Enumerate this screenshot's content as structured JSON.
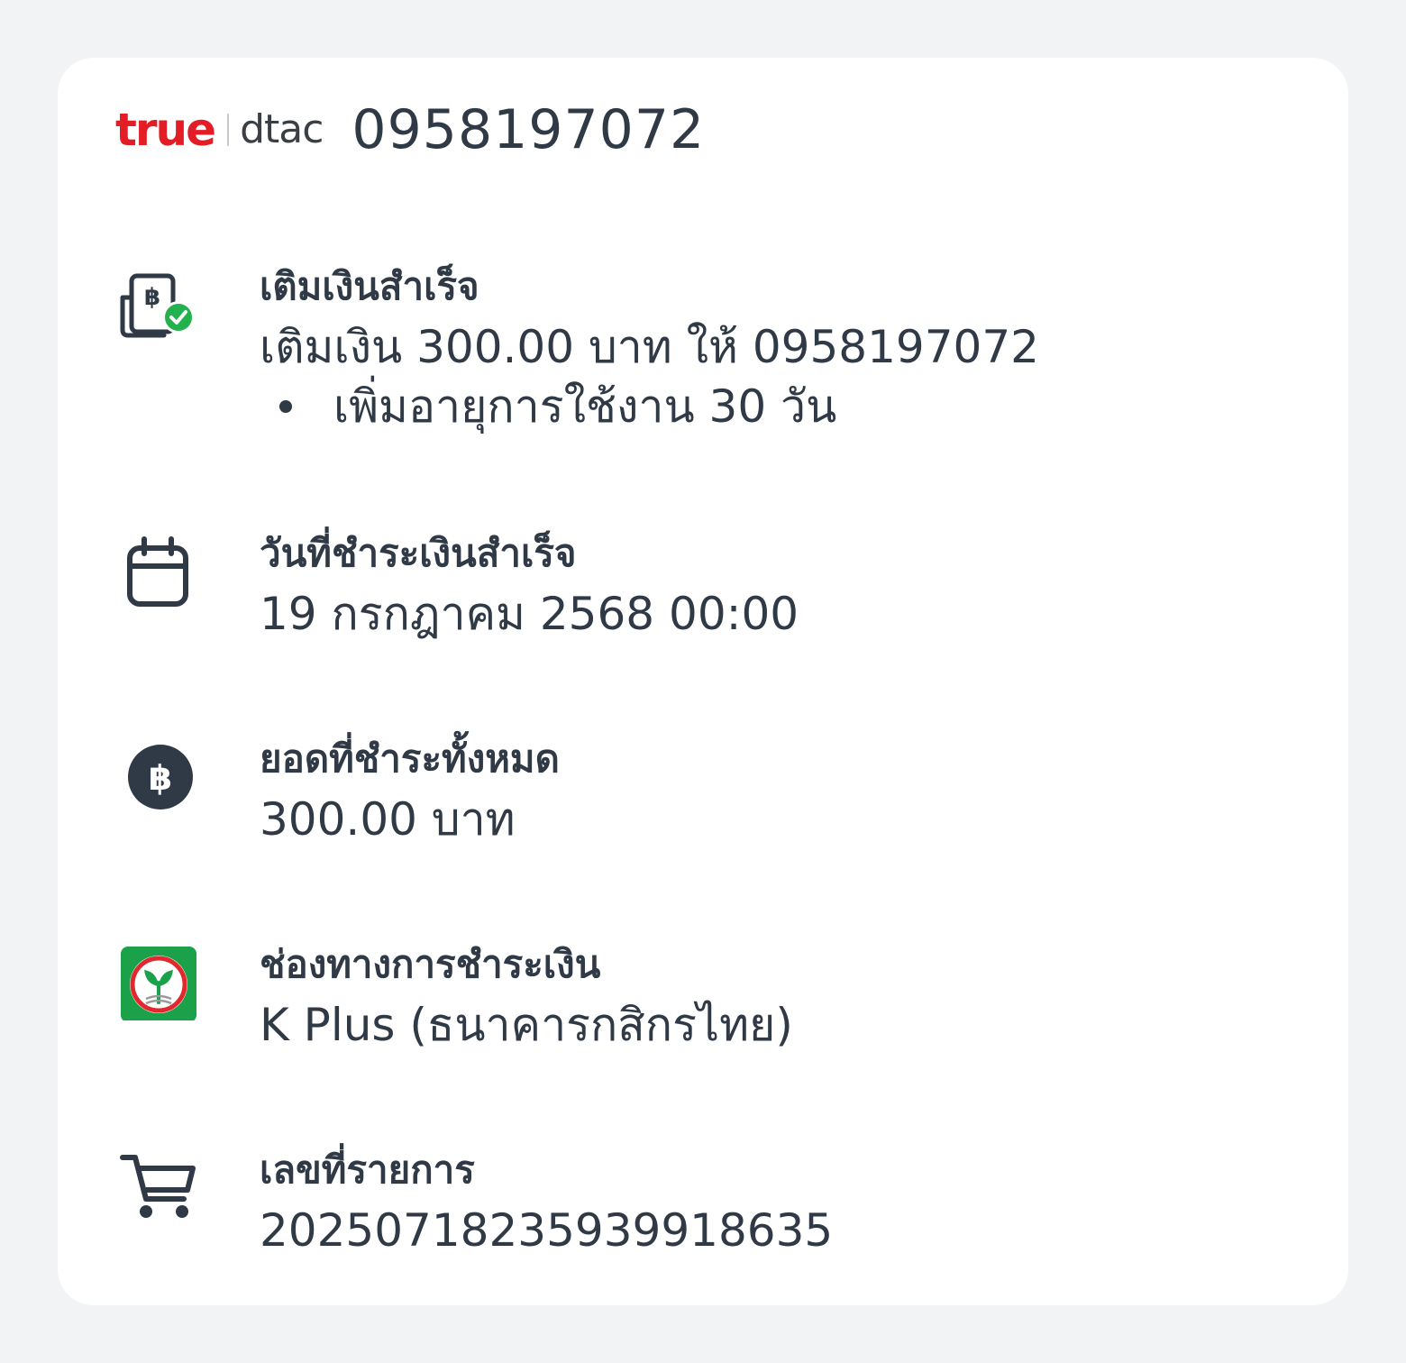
{
  "header": {
    "brand_true": "true",
    "brand_dtac": "dtac",
    "phone": "0958197072"
  },
  "items": [
    {
      "icon": "wallet-check-icon",
      "label": "เติมเงินสำเร็จ",
      "value": "เติมเงิน 300.00 บาท ให้ 0958197072",
      "bullet": "เพิ่มอายุการใช้งาน 30 วัน"
    },
    {
      "icon": "calendar-icon",
      "label": "วันที่ชำระเงินสำเร็จ",
      "value": "19 กรกฎาคม 2568 00:00"
    },
    {
      "icon": "baht-coin-icon",
      "label": "ยอดที่ชำระทั้งหมด",
      "value": "300.00 บาท"
    },
    {
      "icon": "kplus-logo-icon",
      "label": "ช่องทางการชำระเงิน",
      "value": "K Plus (ธนาคารกสิกรไทย)"
    },
    {
      "icon": "cart-icon",
      "label": "เลขที่รายการ",
      "value": "20250718235939918635"
    }
  ],
  "colors": {
    "background": "#f2f3f5",
    "card": "#ffffff",
    "text": "#2f3a46",
    "true_red": "#e21d25",
    "success_green": "#22b14c",
    "kbank_green": "#1aa14a",
    "kbank_red": "#e0282e"
  }
}
